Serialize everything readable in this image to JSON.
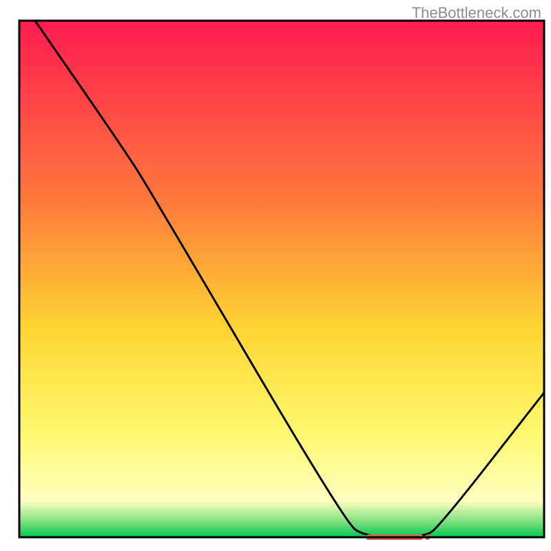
{
  "watermark": "TheBottleneck.com",
  "chart_data": {
    "type": "line",
    "title": "",
    "xlabel": "",
    "ylabel": "",
    "x_range": [
      0,
      100
    ],
    "y_range": [
      0,
      100
    ],
    "curve": [
      {
        "x": 3,
        "y": 100
      },
      {
        "x": 20,
        "y": 75
      },
      {
        "x": 25,
        "y": 67
      },
      {
        "x": 62,
        "y": 3
      },
      {
        "x": 66,
        "y": 0
      },
      {
        "x": 77,
        "y": 0
      },
      {
        "x": 80,
        "y": 2
      },
      {
        "x": 100,
        "y": 28
      }
    ],
    "marker": {
      "x_start": 66,
      "x_end": 77,
      "y": 0
    },
    "gradient_stops": [
      {
        "offset": 0,
        "color": "#ff1a50"
      },
      {
        "offset": 35,
        "color": "#ff7a3c"
      },
      {
        "offset": 60,
        "color": "#ffd633"
      },
      {
        "offset": 80,
        "color": "#fff86f"
      },
      {
        "offset": 93,
        "color": "#ffffc1"
      },
      {
        "offset": 97,
        "color": "#7fe07f"
      },
      {
        "offset": 100,
        "color": "#00c94f"
      }
    ],
    "frame_color": "#000000",
    "marker_color": "#d9694f",
    "curve_color": "#000000"
  }
}
